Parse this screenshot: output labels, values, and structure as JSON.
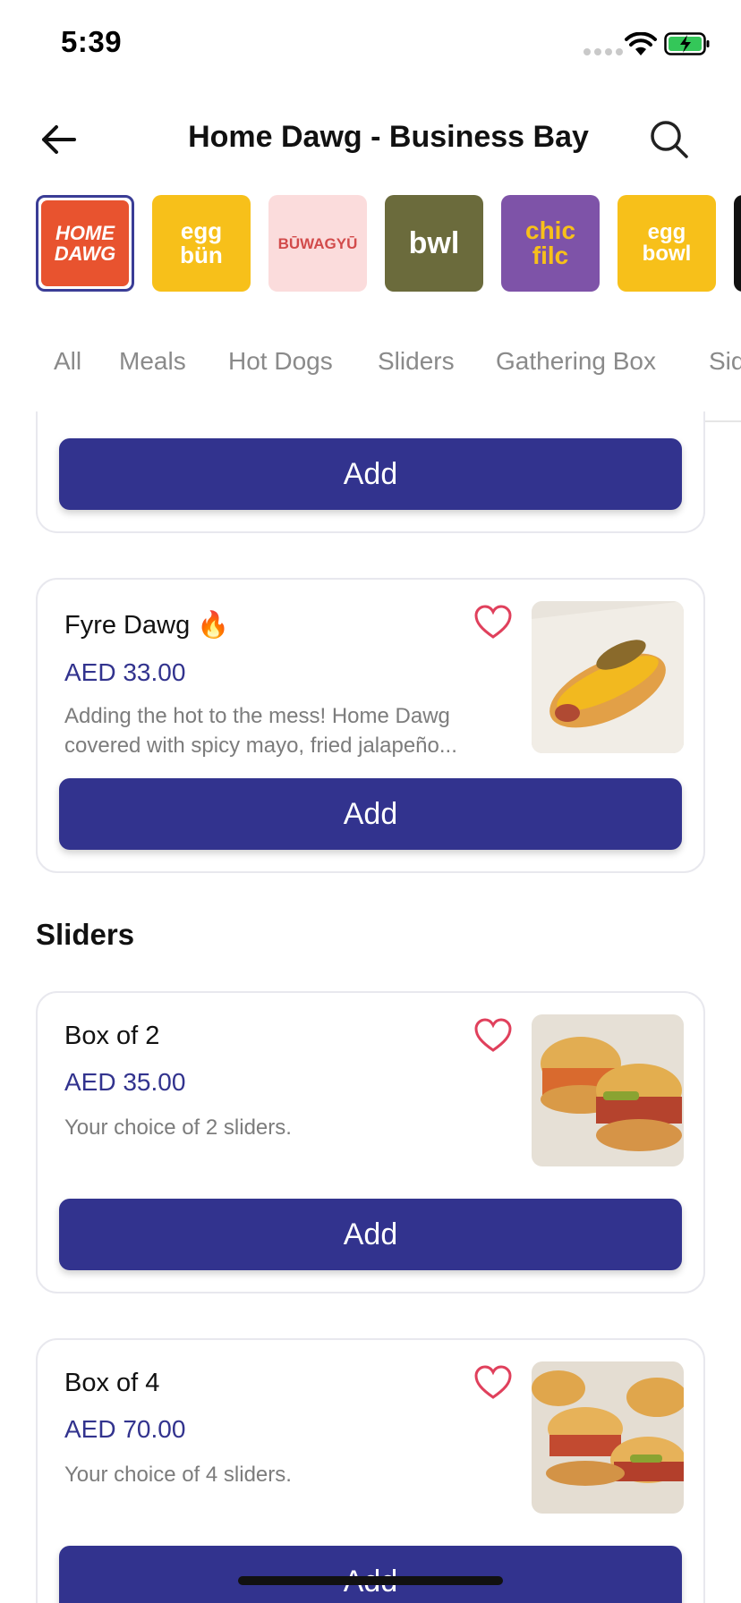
{
  "status": {
    "time": "5:39"
  },
  "nav": {
    "title": "Home Dawg - Business Bay"
  },
  "brands": [
    {
      "text": "HOME DAWG",
      "bg": "#e8532f",
      "fg": "#ffffff",
      "selected": true
    },
    {
      "text": "egg bün",
      "bg": "#f7c01a",
      "fg": "#ffffff"
    },
    {
      "text": "BŪWAGYŪ",
      "bg": "#fbdcdc",
      "fg": "#d24b4b"
    },
    {
      "text": "bwl",
      "bg": "#6b6b3c",
      "fg": "#ffffff"
    },
    {
      "text": "chic filc",
      "bg": "#7e53a8",
      "fg": "#f7c01a"
    },
    {
      "text": "egg bowl",
      "bg": "#f7c01a",
      "fg": "#ffffff"
    }
  ],
  "tabs": [
    "All",
    "Meals",
    "Hot Dogs",
    "Sliders",
    "Gathering Box",
    "Sid"
  ],
  "labels": {
    "add": "Add"
  },
  "sections": {
    "sliders": "Sliders"
  },
  "items": {
    "fyre_dawg": {
      "name": "Fyre Dawg 🔥",
      "price": "AED 33.00",
      "description": "Adding the hot to the mess! Home Dawg covered with spicy mayo, fried jalapeño..."
    },
    "box_of_2": {
      "name": "Box of 2",
      "price": "AED 35.00",
      "description": "Your choice of 2 sliders."
    },
    "box_of_4": {
      "name": "Box of 4",
      "price": "AED 70.00",
      "description": "Your choice of 4 sliders."
    }
  },
  "colors": {
    "accent": "#32338e",
    "heart": "#e0405c"
  }
}
